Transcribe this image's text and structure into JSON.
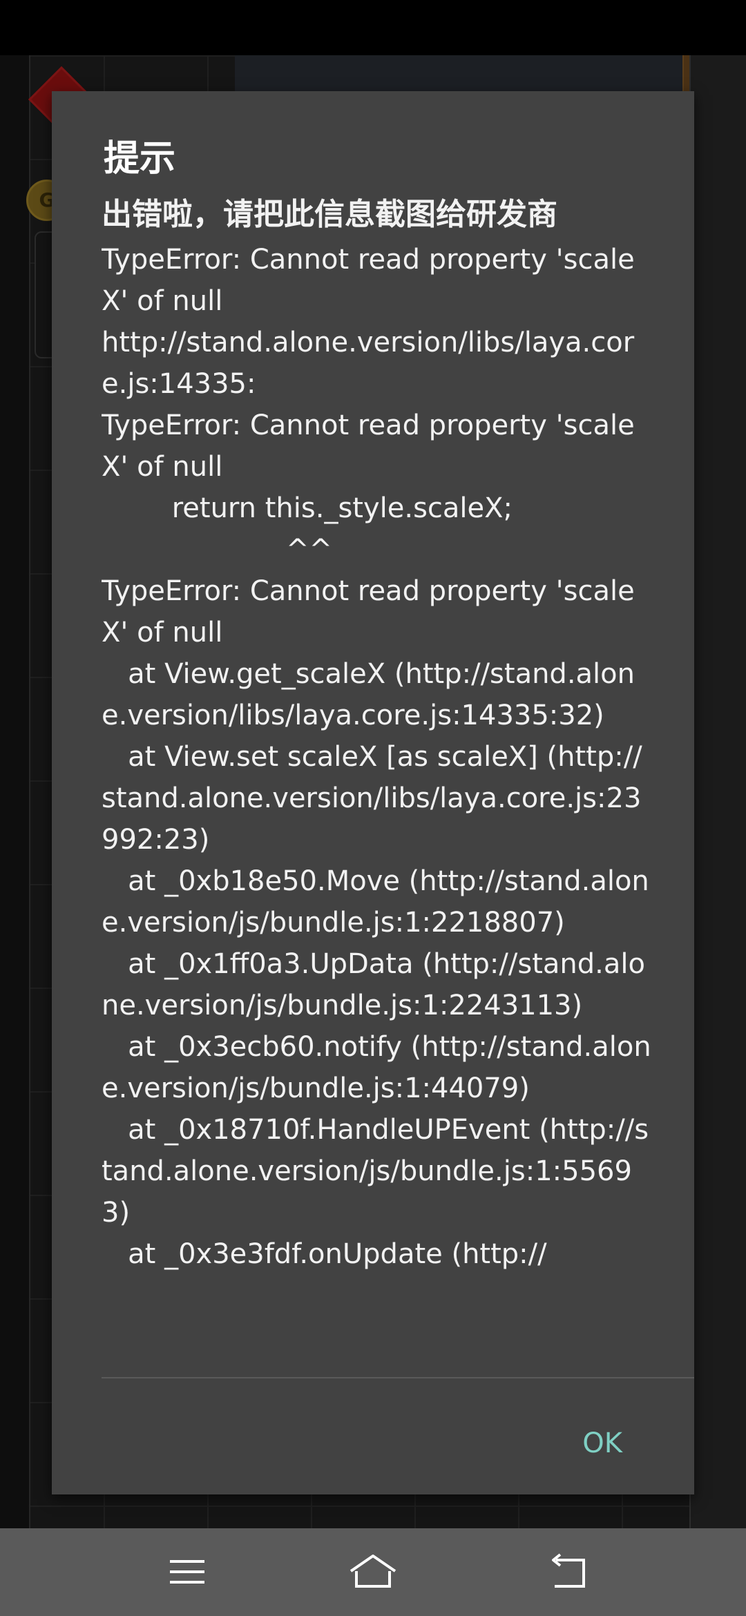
{
  "background": {
    "coin_label": "G"
  },
  "dialog": {
    "title": "提示",
    "heading": "出错啦，请把此信息截图给研发商",
    "message": "TypeError: Cannot read property 'scaleX' of null\nhttp://stand.alone.version/libs/laya.core.js:14335:\nTypeError: Cannot read property 'scaleX' of null\n        return this._style.scaleX;\n                     ^^\nTypeError: Cannot read property 'scaleX' of null\n   at View.get_scaleX (http://stand.alone.version/libs/laya.core.js:14335:32)\n   at View.set scaleX [as scaleX] (http://stand.alone.version/libs/laya.core.js:23992:23)\n   at _0xb18e50.Move (http://stand.alone.version/js/bundle.js:1:2218807)\n   at _0x1ff0a3.UpData (http://stand.alone.version/js/bundle.js:1:2243113)\n   at _0x3ecb60.notify (http://stand.alone.version/js/bundle.js:1:44079)\n   at _0x18710f.HandleUPEvent (http://stand.alone.version/js/bundle.js:1:55693)\n   at _0x3e3fdf.onUpdate (http://",
    "ok_label": "OK",
    "ok_color": "#7fd0c4",
    "background_color": "#424242"
  },
  "navbar": {
    "menu_icon": "menu-icon",
    "home_icon": "home-icon",
    "back_icon": "back-icon"
  }
}
